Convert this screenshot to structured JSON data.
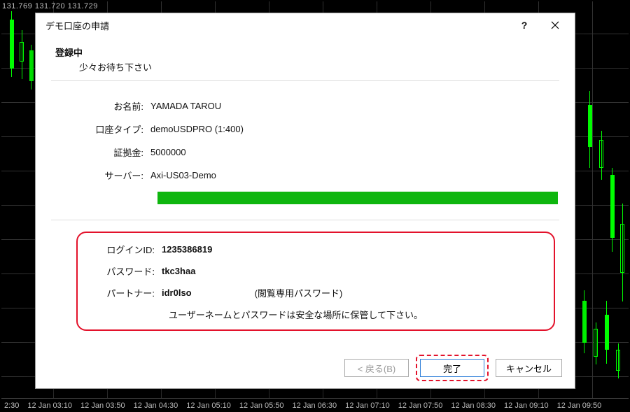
{
  "chart": {
    "ohlc_text": "131.769 131.720 131.729",
    "time_labels": [
      "2:30",
      "12 Jan 03:10",
      "12 Jan 03:50",
      "12 Jan 04:30",
      "12 Jan 05:10",
      "12 Jan 05:50",
      "12 Jan 06:30",
      "12 Jan 07:10",
      "12 Jan 07:50",
      "12 Jan 08:30",
      "12 Jan 09:10",
      "12 Jan 09:50"
    ]
  },
  "dialog": {
    "title": "デモ口座の申請",
    "section_title": "登録中",
    "section_sub": "少々お待ち下さい",
    "account": {
      "name_label": "お名前:",
      "name_value": "YAMADA TAROU",
      "type_label": "口座タイプ:",
      "type_value": "demoUSDPRO (1:400)",
      "margin_label": "証拠金:",
      "margin_value": "5000000",
      "server_label": "サーバー:",
      "server_value": "Axi-US03-Demo"
    },
    "credentials": {
      "login_label": "ログインID:",
      "login_value": "1235386819",
      "password_label": "パスワード:",
      "password_value": "tkc3haa",
      "partner_label": "パートナー:",
      "partner_value": "idr0lso",
      "readonly_note": "(閲覧専用パスワード)",
      "warning": "ユーザーネームとパスワードは安全な場所に保管して下さい。"
    },
    "buttons": {
      "back": "< 戻る(B)",
      "finish": "完了",
      "cancel": "キャンセル"
    }
  }
}
